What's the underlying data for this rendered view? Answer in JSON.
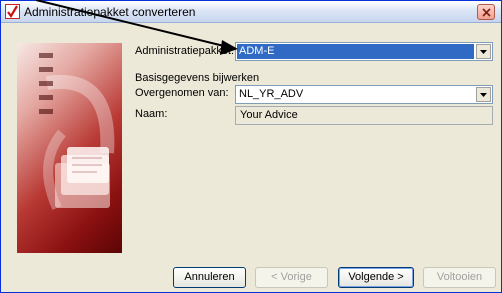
{
  "window": {
    "title": "Administratiepakket converteren"
  },
  "form": {
    "package_label": "Administratiepakket:",
    "package_value": "ADM-E",
    "section_label": "Basisgegevens bijwerken",
    "source_label": "Overgenomen van:",
    "source_value": "NL_YR_ADV",
    "name_label": "Naam:",
    "name_value": "Your Advice"
  },
  "buttons": {
    "cancel": "Annuleren",
    "previous": "< Vorige",
    "next": "Volgende >",
    "finish": "Voltooien"
  },
  "colors": {
    "selection": "#316ac5",
    "panel_accent": "#8a1010"
  }
}
